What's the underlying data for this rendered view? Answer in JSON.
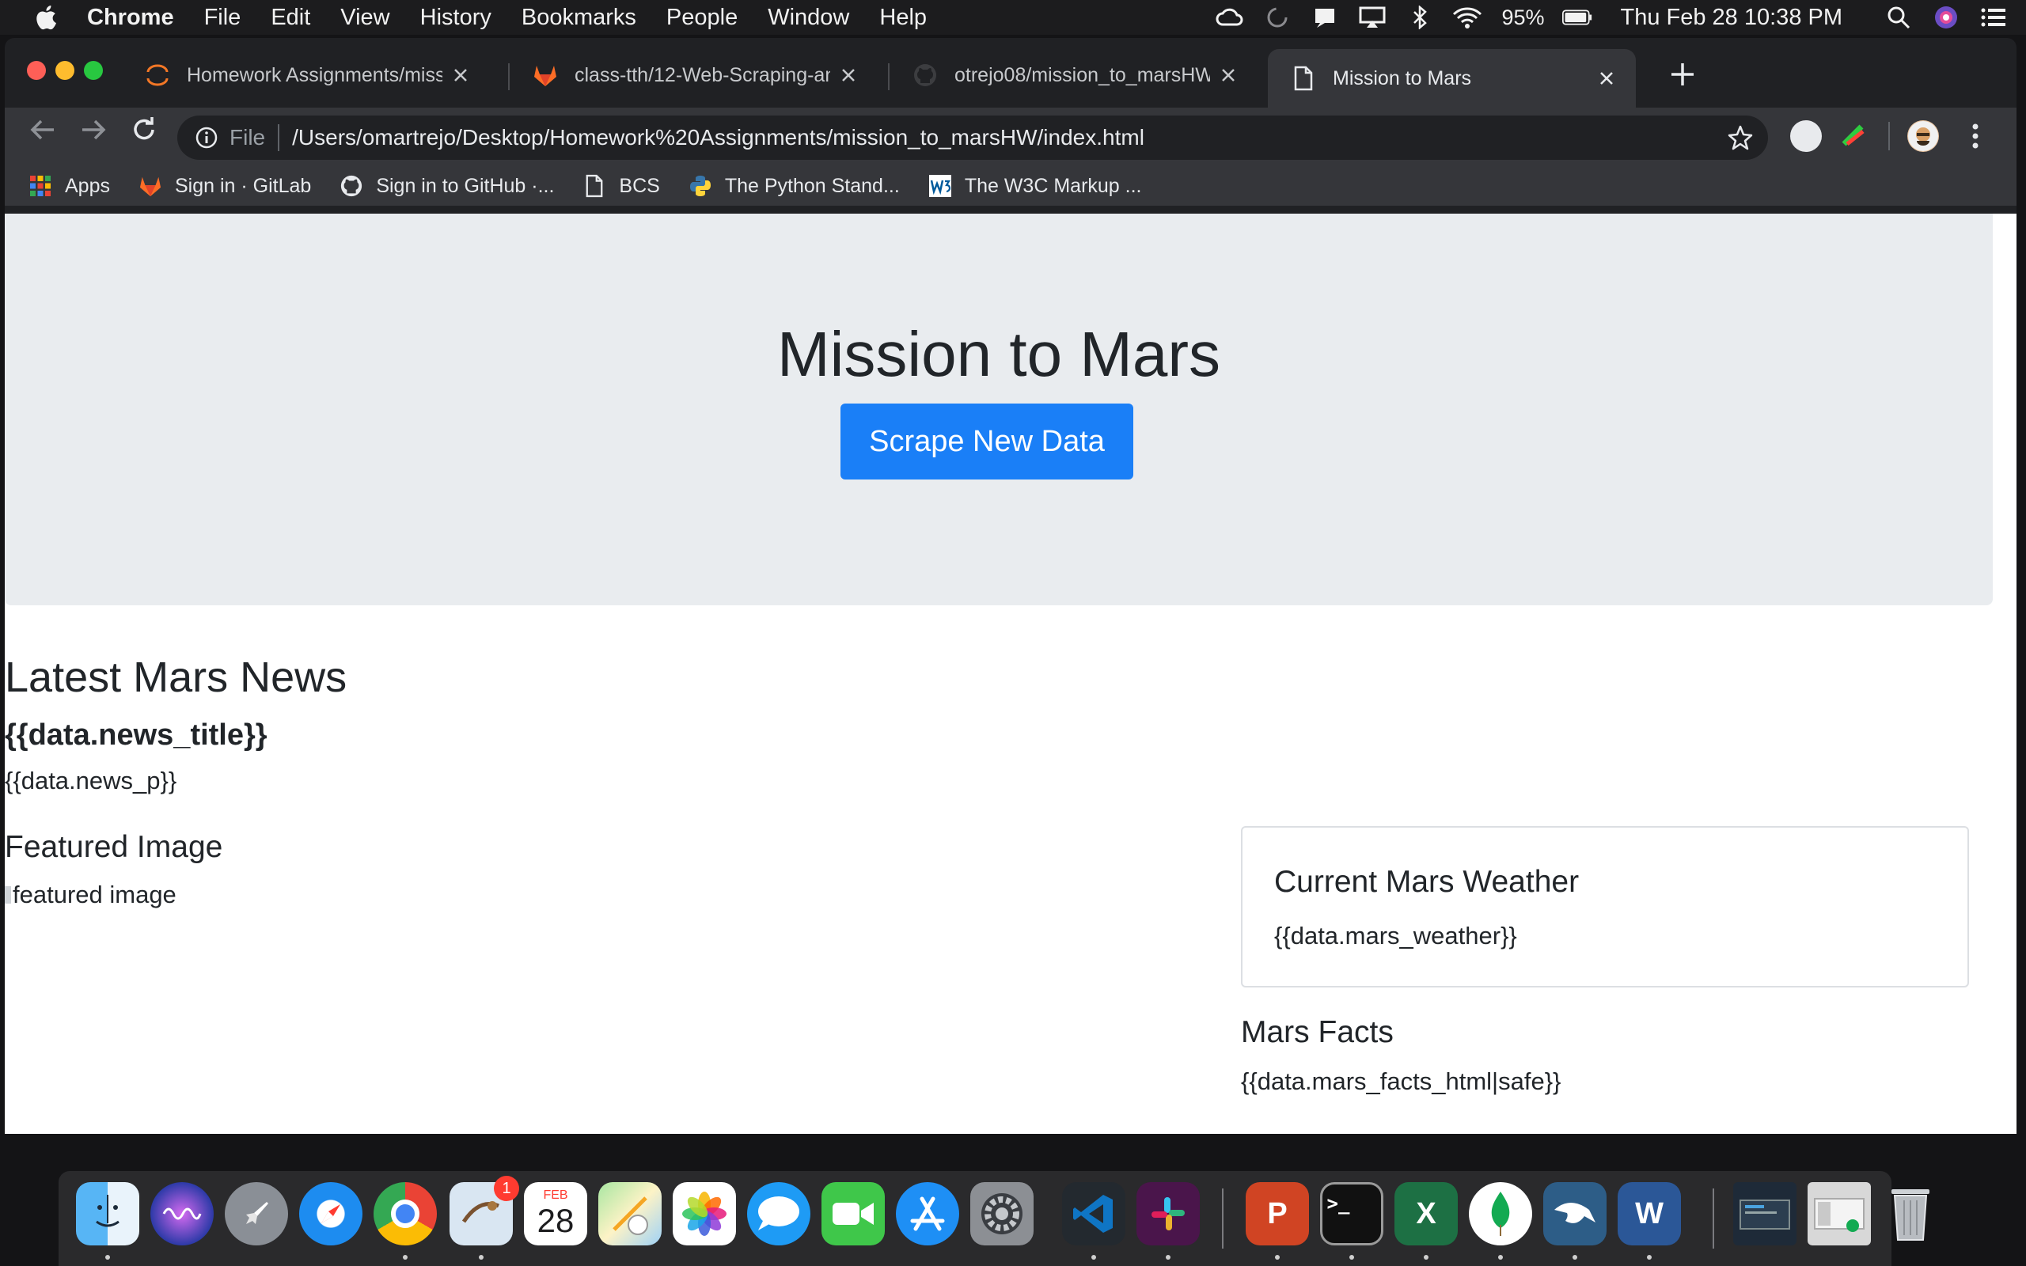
{
  "menubar": {
    "app_name": "Chrome",
    "items": [
      "File",
      "Edit",
      "View",
      "History",
      "Bookmarks",
      "People",
      "Window",
      "Help"
    ],
    "battery_percent": "95%",
    "clock": "Thu Feb 28  10:38 PM"
  },
  "browser": {
    "tabs": [
      {
        "title": "Homework Assignments/missio",
        "icon": "jupyter-icon"
      },
      {
        "title": "class-tth/12-Web-Scraping-an",
        "icon": "gitlab-icon"
      },
      {
        "title": "otrejo08/mission_to_marsHW",
        "icon": "github-icon"
      },
      {
        "title": "Mission to Mars",
        "icon": "file-icon",
        "active": true
      }
    ],
    "omnibox": {
      "scheme": "File",
      "url": "/Users/omartrejo/Desktop/Homework%20Assignments/mission_to_marsHW/index.html"
    },
    "bookmarks": [
      {
        "label": "Apps",
        "icon": "apps-grid-icon"
      },
      {
        "label": "Sign in · GitLab",
        "icon": "gitlab-icon"
      },
      {
        "label": "Sign in to GitHub ·...",
        "icon": "github-icon"
      },
      {
        "label": "BCS",
        "icon": "file-icon"
      },
      {
        "label": "The Python Stand...",
        "icon": "python-icon"
      },
      {
        "label": "The W3C Markup ...",
        "icon": "w3c-icon"
      }
    ]
  },
  "page": {
    "title": "Mission to Mars",
    "scrape_button": "Scrape New Data",
    "news_heading": "Latest Mars News",
    "news_title": "{{data.news_title}}",
    "news_p": "{{data.news_p}}",
    "featured_heading": "Featured Image",
    "featured_img_alt": "featured image",
    "weather_heading": "Current Mars Weather",
    "weather_value": "{{data.mars_weather}}",
    "facts_heading": "Mars Facts",
    "facts_value": "{{data.mars_facts_html|safe}}"
  },
  "colors": {
    "jumbotron_bg": "#e9ecef",
    "primary_button": "#1a7ff7",
    "text": "#212529"
  },
  "dock": {
    "calendar_month": "FEB",
    "calendar_day": "28",
    "mail_badge": "1",
    "apps": [
      "Finder",
      "Siri",
      "Launchpad",
      "Safari",
      "Google Chrome",
      "Mail",
      "Calendar",
      "Maps",
      "Photos",
      "Messages",
      "FaceTime",
      "App Store",
      "System Preferences",
      "Visual Studio Code",
      "Slack",
      "PowerPoint",
      "Terminal",
      "Excel",
      "MongoDB Compass",
      "MySQL Workbench",
      "Word",
      "Downloads",
      "Documents",
      "Trash"
    ]
  }
}
